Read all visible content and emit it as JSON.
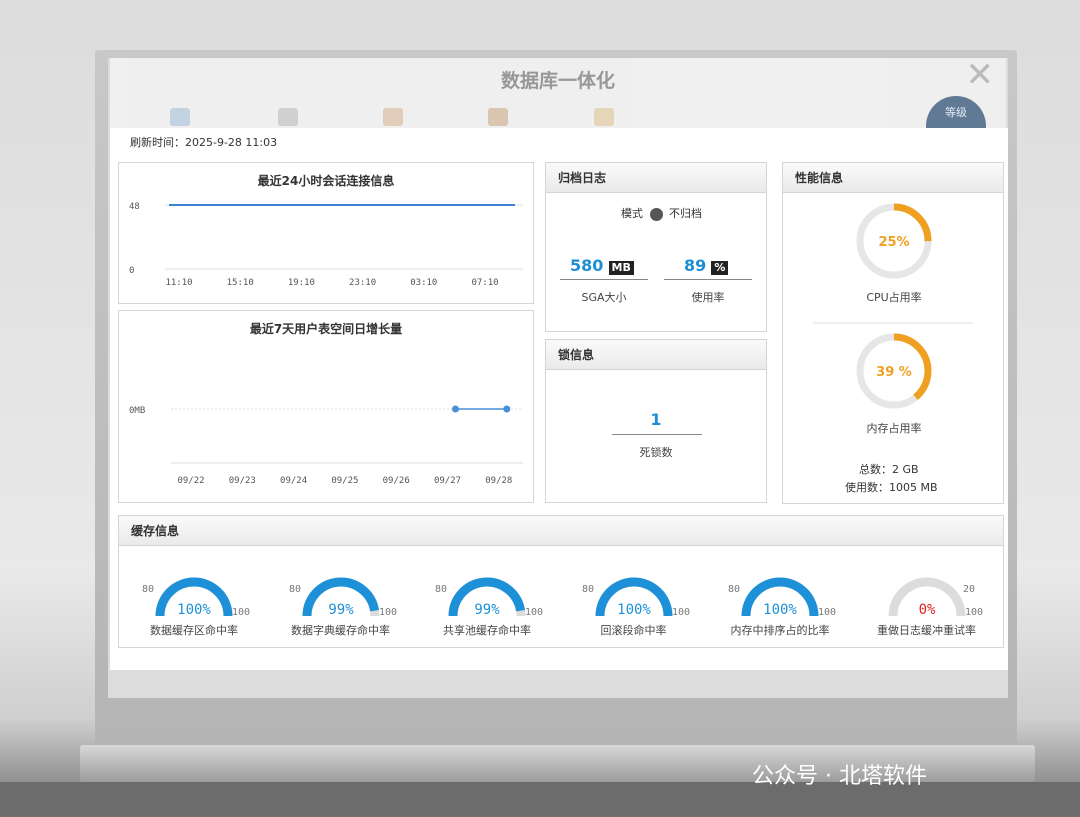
{
  "dialog": {
    "title": "数据库一体化",
    "badge": "等级"
  },
  "refresh": {
    "label": "刷新时间：2025-9-28 11:03"
  },
  "sessions_chart": {
    "title": "最近24小时会话连接信息",
    "chart_data": {
      "type": "line",
      "title": "最近24小时会话连接信息",
      "x": [
        "11:10",
        "15:10",
        "19:10",
        "23:10",
        "03:10",
        "07:10"
      ],
      "yticks": [
        "48",
        "0"
      ],
      "series": [
        {
          "values": [
            48,
            48,
            48,
            48,
            48,
            48
          ]
        }
      ],
      "ylim": [
        0,
        48
      ],
      "color": "#3b82d6"
    }
  },
  "growth_chart": {
    "title": "最近7天用户表空间日增长量",
    "chart_data": {
      "type": "line",
      "title": "最近7天用户表空间日增长量",
      "categories": [
        "09/22",
        "09/23",
        "09/24",
        "09/25",
        "09/26",
        "09/27",
        "09/28"
      ],
      "ytick": "0MB",
      "series": [
        {
          "points": [
            [
              "09/27",
              0
            ],
            [
              "09/28",
              0
            ]
          ]
        }
      ],
      "color": "#4a90d9"
    }
  },
  "archive": {
    "title": "归档日志",
    "mode_label": "模式",
    "mode_value": "不归档",
    "sga_value": "580",
    "sga_unit": "MB",
    "sga_label": "SGA大小",
    "usage_value": "89",
    "usage_unit": "%",
    "usage_label": "使用率"
  },
  "lock": {
    "title": "锁信息",
    "deadlock_value": "1",
    "deadlock_label": "死锁数"
  },
  "performance": {
    "title": "性能信息",
    "cpu_value": "25%",
    "cpu_fraction": 0.25,
    "cpu_label": "CPU占用率",
    "mem_value": "39 %",
    "mem_fraction": 0.39,
    "mem_label": "内存占用率",
    "total_label": "总数：",
    "total_value": "2 GB",
    "used_label": "使用数：",
    "used_value": "1005 MB",
    "accent": "#f0a020"
  },
  "cache": {
    "title": "缓存信息",
    "gauges": [
      {
        "value": "100%",
        "fraction": 1.0,
        "min": "80",
        "max": "100",
        "label": "数据缓存区命中率",
        "color": "#1e90d8"
      },
      {
        "value": "99%",
        "fraction": 0.95,
        "min": "80",
        "max": "100",
        "label": "数据字典缓存命中率",
        "color": "#1e90d8"
      },
      {
        "value": "99%",
        "fraction": 0.95,
        "min": "80",
        "max": "100",
        "label": "共享池缓存命中率",
        "color": "#1e90d8"
      },
      {
        "value": "100%",
        "fraction": 1.0,
        "min": "80",
        "max": "100",
        "label": "回滚段命中率",
        "color": "#1e90d8"
      },
      {
        "value": "100%",
        "fraction": 1.0,
        "min": "80",
        "max": "100",
        "label": "内存中排序占的比率",
        "color": "#1e90d8"
      },
      {
        "value": "0%",
        "fraction": 0.0,
        "min": "",
        "max": "20",
        "max2": "100",
        "label": "重做日志缓冲重试率",
        "color": "#e02020"
      }
    ]
  },
  "watermark": "公众号 · 北塔软件"
}
